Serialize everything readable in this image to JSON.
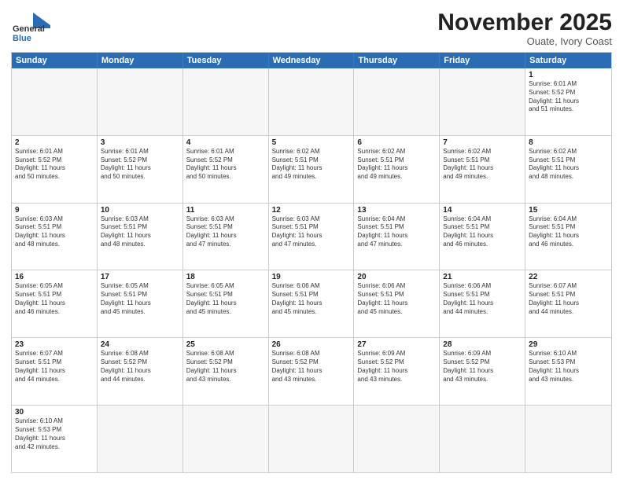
{
  "header": {
    "logo_general": "General",
    "logo_blue": "Blue",
    "month_title": "November 2025",
    "subtitle": "Ouate, Ivory Coast"
  },
  "days": [
    "Sunday",
    "Monday",
    "Tuesday",
    "Wednesday",
    "Thursday",
    "Friday",
    "Saturday"
  ],
  "weeks": [
    [
      {
        "day": "",
        "info": "",
        "empty": true
      },
      {
        "day": "",
        "info": "",
        "empty": true
      },
      {
        "day": "",
        "info": "",
        "empty": true
      },
      {
        "day": "",
        "info": "",
        "empty": true
      },
      {
        "day": "",
        "info": "",
        "empty": true
      },
      {
        "day": "",
        "info": "",
        "empty": true
      },
      {
        "day": "1",
        "info": "Sunrise: 6:01 AM\nSunset: 5:52 PM\nDaylight: 11 hours\nand 51 minutes.",
        "empty": false
      }
    ],
    [
      {
        "day": "2",
        "info": "Sunrise: 6:01 AM\nSunset: 5:52 PM\nDaylight: 11 hours\nand 50 minutes.",
        "empty": false
      },
      {
        "day": "3",
        "info": "Sunrise: 6:01 AM\nSunset: 5:52 PM\nDaylight: 11 hours\nand 50 minutes.",
        "empty": false
      },
      {
        "day": "4",
        "info": "Sunrise: 6:01 AM\nSunset: 5:52 PM\nDaylight: 11 hours\nand 50 minutes.",
        "empty": false
      },
      {
        "day": "5",
        "info": "Sunrise: 6:02 AM\nSunset: 5:51 PM\nDaylight: 11 hours\nand 49 minutes.",
        "empty": false
      },
      {
        "day": "6",
        "info": "Sunrise: 6:02 AM\nSunset: 5:51 PM\nDaylight: 11 hours\nand 49 minutes.",
        "empty": false
      },
      {
        "day": "7",
        "info": "Sunrise: 6:02 AM\nSunset: 5:51 PM\nDaylight: 11 hours\nand 49 minutes.",
        "empty": false
      },
      {
        "day": "8",
        "info": "Sunrise: 6:02 AM\nSunset: 5:51 PM\nDaylight: 11 hours\nand 48 minutes.",
        "empty": false
      }
    ],
    [
      {
        "day": "9",
        "info": "Sunrise: 6:03 AM\nSunset: 5:51 PM\nDaylight: 11 hours\nand 48 minutes.",
        "empty": false
      },
      {
        "day": "10",
        "info": "Sunrise: 6:03 AM\nSunset: 5:51 PM\nDaylight: 11 hours\nand 48 minutes.",
        "empty": false
      },
      {
        "day": "11",
        "info": "Sunrise: 6:03 AM\nSunset: 5:51 PM\nDaylight: 11 hours\nand 47 minutes.",
        "empty": false
      },
      {
        "day": "12",
        "info": "Sunrise: 6:03 AM\nSunset: 5:51 PM\nDaylight: 11 hours\nand 47 minutes.",
        "empty": false
      },
      {
        "day": "13",
        "info": "Sunrise: 6:04 AM\nSunset: 5:51 PM\nDaylight: 11 hours\nand 47 minutes.",
        "empty": false
      },
      {
        "day": "14",
        "info": "Sunrise: 6:04 AM\nSunset: 5:51 PM\nDaylight: 11 hours\nand 46 minutes.",
        "empty": false
      },
      {
        "day": "15",
        "info": "Sunrise: 6:04 AM\nSunset: 5:51 PM\nDaylight: 11 hours\nand 46 minutes.",
        "empty": false
      }
    ],
    [
      {
        "day": "16",
        "info": "Sunrise: 6:05 AM\nSunset: 5:51 PM\nDaylight: 11 hours\nand 46 minutes.",
        "empty": false
      },
      {
        "day": "17",
        "info": "Sunrise: 6:05 AM\nSunset: 5:51 PM\nDaylight: 11 hours\nand 45 minutes.",
        "empty": false
      },
      {
        "day": "18",
        "info": "Sunrise: 6:05 AM\nSunset: 5:51 PM\nDaylight: 11 hours\nand 45 minutes.",
        "empty": false
      },
      {
        "day": "19",
        "info": "Sunrise: 6:06 AM\nSunset: 5:51 PM\nDaylight: 11 hours\nand 45 minutes.",
        "empty": false
      },
      {
        "day": "20",
        "info": "Sunrise: 6:06 AM\nSunset: 5:51 PM\nDaylight: 11 hours\nand 45 minutes.",
        "empty": false
      },
      {
        "day": "21",
        "info": "Sunrise: 6:06 AM\nSunset: 5:51 PM\nDaylight: 11 hours\nand 44 minutes.",
        "empty": false
      },
      {
        "day": "22",
        "info": "Sunrise: 6:07 AM\nSunset: 5:51 PM\nDaylight: 11 hours\nand 44 minutes.",
        "empty": false
      }
    ],
    [
      {
        "day": "23",
        "info": "Sunrise: 6:07 AM\nSunset: 5:51 PM\nDaylight: 11 hours\nand 44 minutes.",
        "empty": false
      },
      {
        "day": "24",
        "info": "Sunrise: 6:08 AM\nSunset: 5:52 PM\nDaylight: 11 hours\nand 44 minutes.",
        "empty": false
      },
      {
        "day": "25",
        "info": "Sunrise: 6:08 AM\nSunset: 5:52 PM\nDaylight: 11 hours\nand 43 minutes.",
        "empty": false
      },
      {
        "day": "26",
        "info": "Sunrise: 6:08 AM\nSunset: 5:52 PM\nDaylight: 11 hours\nand 43 minutes.",
        "empty": false
      },
      {
        "day": "27",
        "info": "Sunrise: 6:09 AM\nSunset: 5:52 PM\nDaylight: 11 hours\nand 43 minutes.",
        "empty": false
      },
      {
        "day": "28",
        "info": "Sunrise: 6:09 AM\nSunset: 5:52 PM\nDaylight: 11 hours\nand 43 minutes.",
        "empty": false
      },
      {
        "day": "29",
        "info": "Sunrise: 6:10 AM\nSunset: 5:53 PM\nDaylight: 11 hours\nand 43 minutes.",
        "empty": false
      }
    ],
    [
      {
        "day": "30",
        "info": "Sunrise: 6:10 AM\nSunset: 5:53 PM\nDaylight: 11 hours\nand 42 minutes.",
        "empty": false
      },
      {
        "day": "",
        "info": "",
        "empty": true
      },
      {
        "day": "",
        "info": "",
        "empty": true
      },
      {
        "day": "",
        "info": "",
        "empty": true
      },
      {
        "day": "",
        "info": "",
        "empty": true
      },
      {
        "day": "",
        "info": "",
        "empty": true
      },
      {
        "day": "",
        "info": "",
        "empty": true
      }
    ]
  ]
}
